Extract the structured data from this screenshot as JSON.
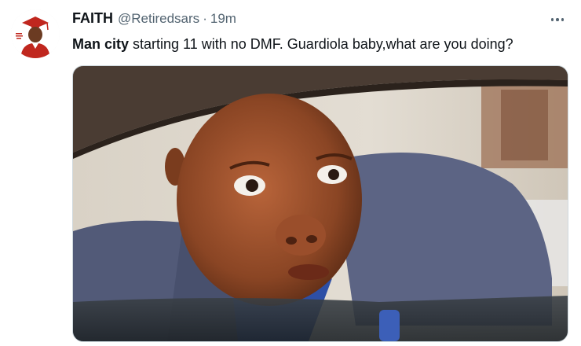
{
  "author": {
    "display_name": "FAITH",
    "handle": "@Retiredsars",
    "separator": "·",
    "time": "19m"
  },
  "tweet": {
    "text_bold": "Man city",
    "text_rest": " starting 11 with no DMF. Guardiola baby,what are you doing?"
  },
  "icons": {
    "more": "more-horizontal-icon",
    "avatar": "profile-avatar"
  },
  "colors": {
    "name": "#0f1419",
    "secondary": "#536471",
    "border": "#cfd9de"
  }
}
